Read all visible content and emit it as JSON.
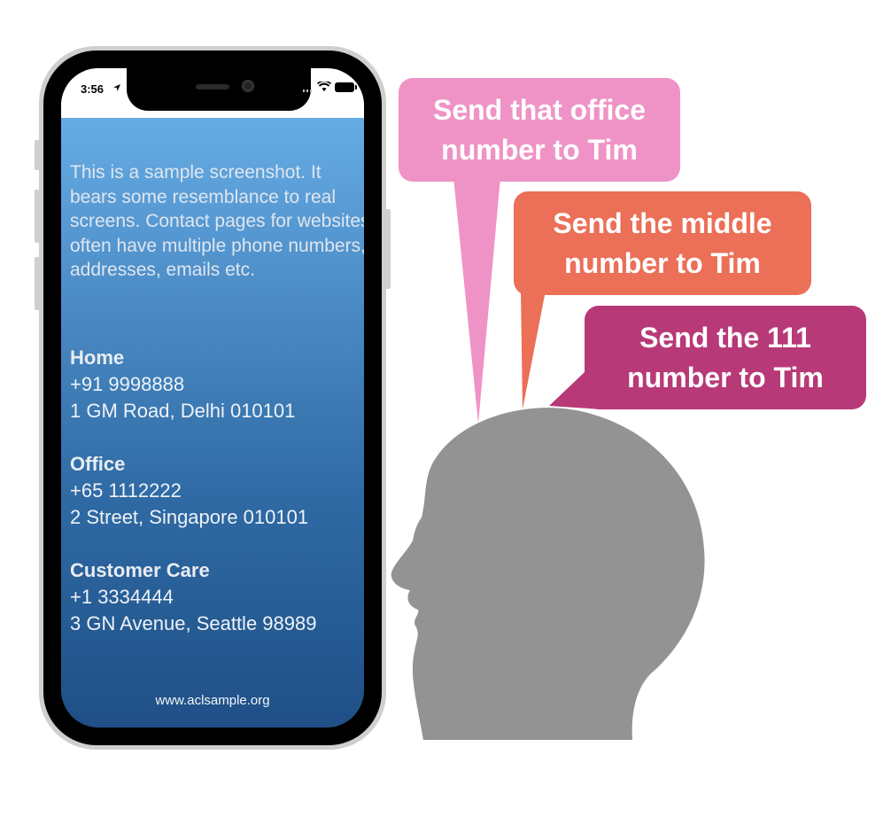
{
  "phone": {
    "status_time": "3:56",
    "intro": "This is a sample screenshot. It bears some resemblance to real screens. Contact pages for websites often have multiple phone numbers, addresses, emails etc.",
    "contacts": [
      {
        "label": "Home",
        "phone": "+91 9998888",
        "address": "1 GM Road, Delhi 010101"
      },
      {
        "label": "Office",
        "phone": "+65 1112222",
        "address": "2 Street, Singapore 010101"
      },
      {
        "label": "Customer Care",
        "phone": "+1 3334444",
        "address": "3 GN Avenue, Seattle 98989"
      }
    ],
    "website": "www.aclsample.org"
  },
  "bubbles": [
    {
      "line1": "Send that office",
      "line2": "number to Tim",
      "color": "#ef93c6"
    },
    {
      "line1": "Send the middle",
      "line2": "number to Tim",
      "color": "#ec6f58"
    },
    {
      "line1": "Send the 111",
      "line2": "number to Tim",
      "color": "#b83977"
    }
  ],
  "colors": {
    "head": "#939393",
    "screen_top": "#6db4ec",
    "screen_bottom": "#1f4f86"
  },
  "icons": [
    "location-arrow-icon",
    "wifi-icon",
    "battery-icon",
    "signal-dots-icon"
  ]
}
